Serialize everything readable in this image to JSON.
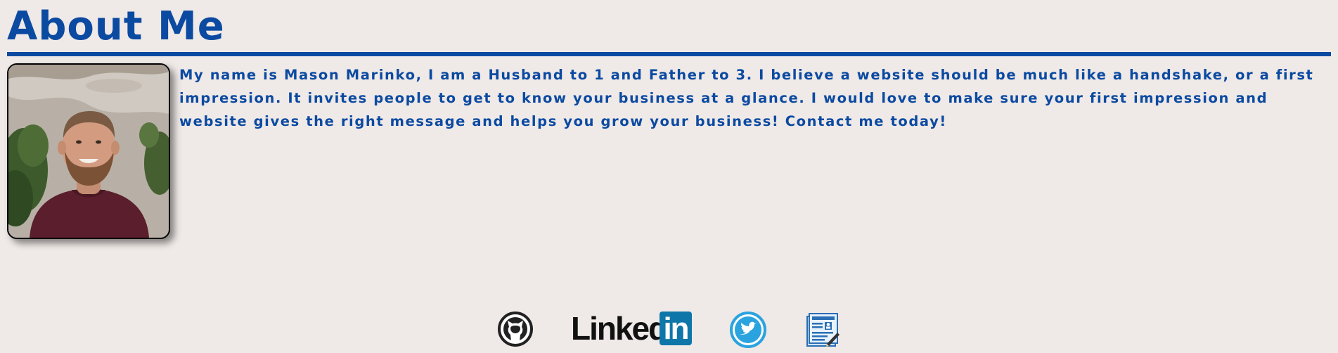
{
  "section": {
    "title": "About Me"
  },
  "profile": {
    "photo_alt": "Mason Marinko",
    "bio": "My name is Mason Marinko, I am a Husband to 1 and Father to 3. I believe a website should be much like a handshake, or a first impression. It invites people to get to know your business at a glance. I would love to make sure your first impression and website gives the right message and helps you grow your business! Contact me today!"
  },
  "social_links": {
    "github": {
      "icon": "github-icon"
    },
    "linkedin": {
      "icon": "linkedin-icon",
      "word": "Linked",
      "badge": "in"
    },
    "twitter": {
      "icon": "twitter-icon"
    },
    "resume": {
      "icon": "resume-icon"
    }
  },
  "colors": {
    "background": "#efe9e7",
    "accent": "#0b4aa1",
    "linkedin_blue": "#0e76a8",
    "twitter_blue": "#2aa3df"
  }
}
